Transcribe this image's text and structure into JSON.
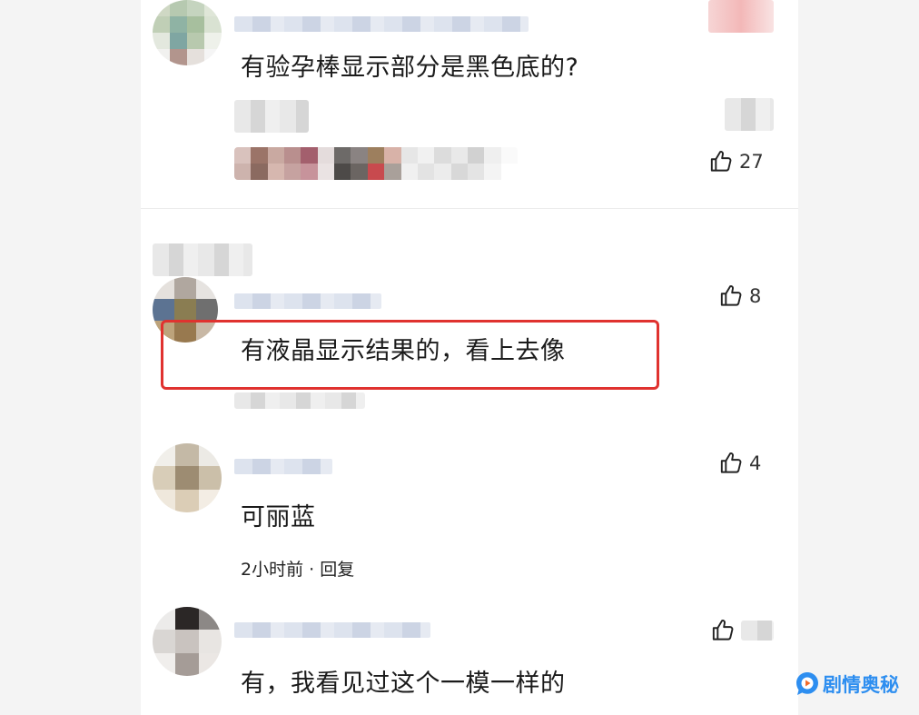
{
  "comments": [
    {
      "text": "有验孕棒显示部分是黑色底的?",
      "likes": "27"
    },
    {
      "text": "有液晶显示结果的，看上去像",
      "likes": "8"
    },
    {
      "text": "可丽蓝",
      "likes": "4",
      "time": "2小时前",
      "separator": "·",
      "reply": "回复"
    },
    {
      "text": "有，我看见过这个一模一样的"
    }
  ],
  "highlight_color": "#e0322f",
  "icons": {
    "like": "thumbs-up-icon",
    "watermark": "play-bubble-icon"
  },
  "watermark": {
    "text": "剧情奥秘",
    "color": "#2d8ef0"
  }
}
